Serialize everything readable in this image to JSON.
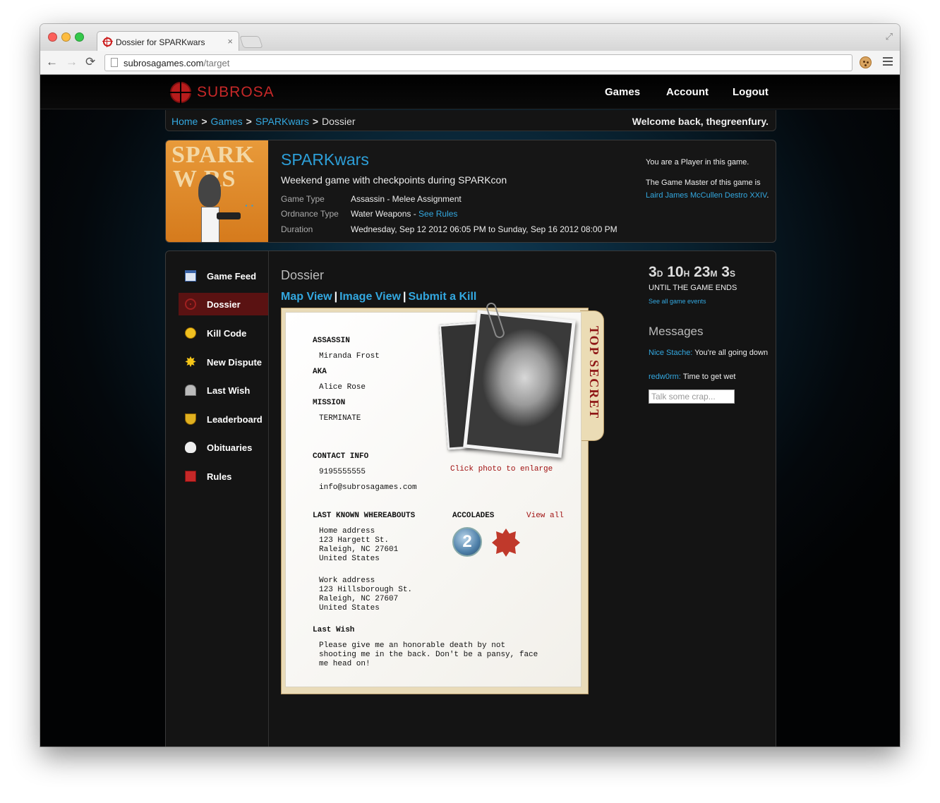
{
  "browser": {
    "tab_title": "Dossier for SPARKwars",
    "tab_close": "×",
    "url_host": "subrosagames.com",
    "url_path": "/target",
    "back": "←",
    "forward": "→",
    "reload": "⟳",
    "fullscreen": "⤢"
  },
  "nav": {
    "logo": "SUBROSA",
    "links": [
      "Games",
      "Account",
      "Logout"
    ]
  },
  "breadcrumb": {
    "items": [
      "Home",
      "Games",
      "SPARKwars",
      "Dossier"
    ],
    "separator": ">",
    "welcome": "Welcome back, thegreenfury."
  },
  "game": {
    "art_title_1": "SPARK",
    "art_title_2": "W  RS",
    "title": "SPARKwars",
    "subtitle": "Weekend game with checkpoints during SPARKcon",
    "type_label": "Game Type",
    "type_value": "Assassin - Melee Assignment",
    "ordnance_label": "Ordnance Type",
    "ordnance_value": "Water Weapons - ",
    "ordnance_link": "See Rules",
    "duration_label": "Duration",
    "duration_value": "Wednesday, Sep 12 2012 06:05 PM to Sunday, Sep 16 2012 08:00 PM",
    "role": "You are a Player in this game.",
    "gm_text": "The Game Master of this game is",
    "gm_name": "Laird James McCullen Destro XXIV",
    "gm_period": "."
  },
  "sidebar": {
    "items": [
      {
        "label": "Game Feed",
        "icon": "feed-icon"
      },
      {
        "label": "Dossier",
        "icon": "crosshair-icon",
        "active": true
      },
      {
        "label": "Kill Code",
        "icon": "angry-face-icon"
      },
      {
        "label": "New Dispute",
        "icon": "star-burst-icon"
      },
      {
        "label": "Last Wish",
        "icon": "tombstone-icon"
      },
      {
        "label": "Leaderboard",
        "icon": "trophy-icon"
      },
      {
        "label": "Obituaries",
        "icon": "skull-icon"
      },
      {
        "label": "Rules",
        "icon": "book-icon"
      }
    ]
  },
  "dossier": {
    "heading": "Dossier",
    "views": [
      "Map View",
      "Image View",
      "Submit a Kill"
    ],
    "view_sep": "|",
    "top_secret": "TOP SECRET",
    "assassin_label": "ASSASSIN",
    "assassin": "Miranda Frost",
    "aka_label": "AKA",
    "aka": "Alice Rose",
    "mission_label": "MISSION",
    "mission": "TERMINATE",
    "photo_hint": "Click photo to enlarge",
    "contact_label": "CONTACT INFO",
    "phone": "9195555555",
    "email": "info@subrosagames.com",
    "whereabouts_label": "LAST KNOWN WHEREABOUTS",
    "home_address": "Home address\n123 Hargett St.\nRaleigh, NC 27601\nUnited States",
    "work_address": "Work address\n123 Hillsborough St.\nRaleigh, NC 27607\nUnited States",
    "accolades_label": "ACCOLADES",
    "view_all": "View all",
    "badge_number": "2",
    "last_wish_label": "Last Wish",
    "last_wish": "Please give me an honorable death by not\nshooting me in the back. Don't be a pansy, face\nme head on!"
  },
  "countdown": {
    "days": "3",
    "days_unit": "D",
    "hours": "10",
    "hours_unit": "H",
    "minutes": "23",
    "minutes_unit": "M",
    "seconds": "3",
    "seconds_unit": "S",
    "until": "UNTIL THE GAME ENDS",
    "events_link": "See all game events"
  },
  "messages": {
    "title": "Messages",
    "items": [
      {
        "author": "Nice Stache:",
        "text": "You're all going down"
      },
      {
        "author": "redw0rm:",
        "text": "Time to get wet"
      }
    ],
    "placeholder": "Talk some crap..."
  },
  "colors": {
    "accent_blue": "#33a8e0",
    "brand_red": "#c62828",
    "active_item": "#5a1212"
  }
}
